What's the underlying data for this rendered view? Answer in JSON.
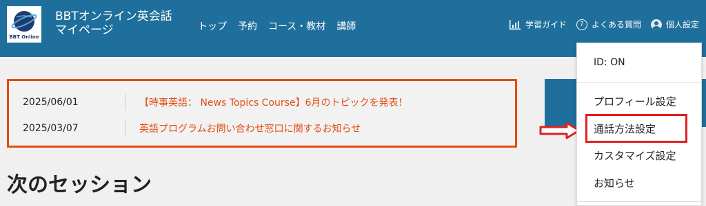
{
  "header": {
    "logo_text": "BBT Online",
    "title_line1": "BBTオンライン英会話",
    "title_line2": "マイページ",
    "nav": [
      "トップ",
      "予約",
      "コース・教材",
      "講師"
    ],
    "guide_label": "学習ガイド",
    "faq_label": "よくある質問",
    "settings_label": "個人設定"
  },
  "news": [
    {
      "date": "2025/06/01",
      "text": "【時事英語： News Topics Course】6月のトピックを発表！"
    },
    {
      "date": "2025/03/07",
      "text": "英語プログラムお問い合わせ窓口に関するお知らせ"
    }
  ],
  "section_title": "次のセッション",
  "dropdown": {
    "id_label": "ID: ON",
    "items": [
      "プロフィール設定",
      "通話方法設定",
      "カスタマイズ設定",
      "お知らせ"
    ]
  },
  "colors": {
    "header_bg": "#1f6f9c",
    "news_accent": "#e04e12",
    "highlight": "#e02020"
  }
}
